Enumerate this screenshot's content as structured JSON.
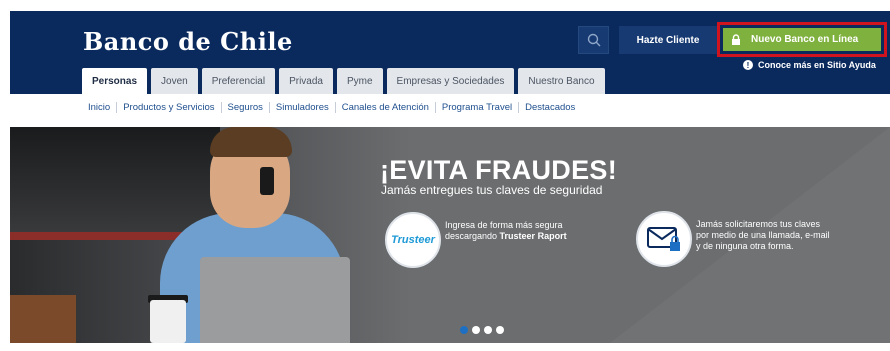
{
  "header": {
    "logo": "Banco de Chile",
    "search_icon": "search-icon",
    "hazte_cliente": "Hazte Cliente",
    "nuevo_banco": "Nuevo Banco en Línea",
    "nuevo_banco_icon": "lock-icon",
    "conoce_mas": "Conoce más en Sitio Ayuda",
    "info_icon": "info-icon",
    "colors": {
      "header_bg": "#0a2a5e",
      "accent_green": "#7fb13f",
      "highlight_red": "#d0141f"
    }
  },
  "tabs": [
    {
      "label": "Personas",
      "active": true
    },
    {
      "label": "Joven"
    },
    {
      "label": "Preferencial"
    },
    {
      "label": "Privada"
    },
    {
      "label": "Pyme"
    },
    {
      "label": "Empresas y Sociedades"
    },
    {
      "label": "Nuestro Banco"
    }
  ],
  "subnav": [
    "Inicio",
    "Productos y Servicios",
    "Seguros",
    "Simuladores",
    "Canales de Atención",
    "Programa Travel",
    "Destacados"
  ],
  "hero": {
    "title": "¡EVITA FRAUDES!",
    "subtitle": "Jamás entregues tus claves de seguridad",
    "trusteer_logo": "Trusteer",
    "feature1_line1": "Ingresa de forma más segura",
    "feature1_line2_prefix": "descargando ",
    "feature1_line2_bold": "Trusteer Raport",
    "feature2_line1": "Jamás solicitaremos tus claves",
    "feature2_line2": "por medio de una llamada, e-mail",
    "feature2_line3": "y de ninguna otra forma.",
    "mail_icon": "mail-lock-icon",
    "carousel_dots": 4,
    "carousel_active": 1
  }
}
